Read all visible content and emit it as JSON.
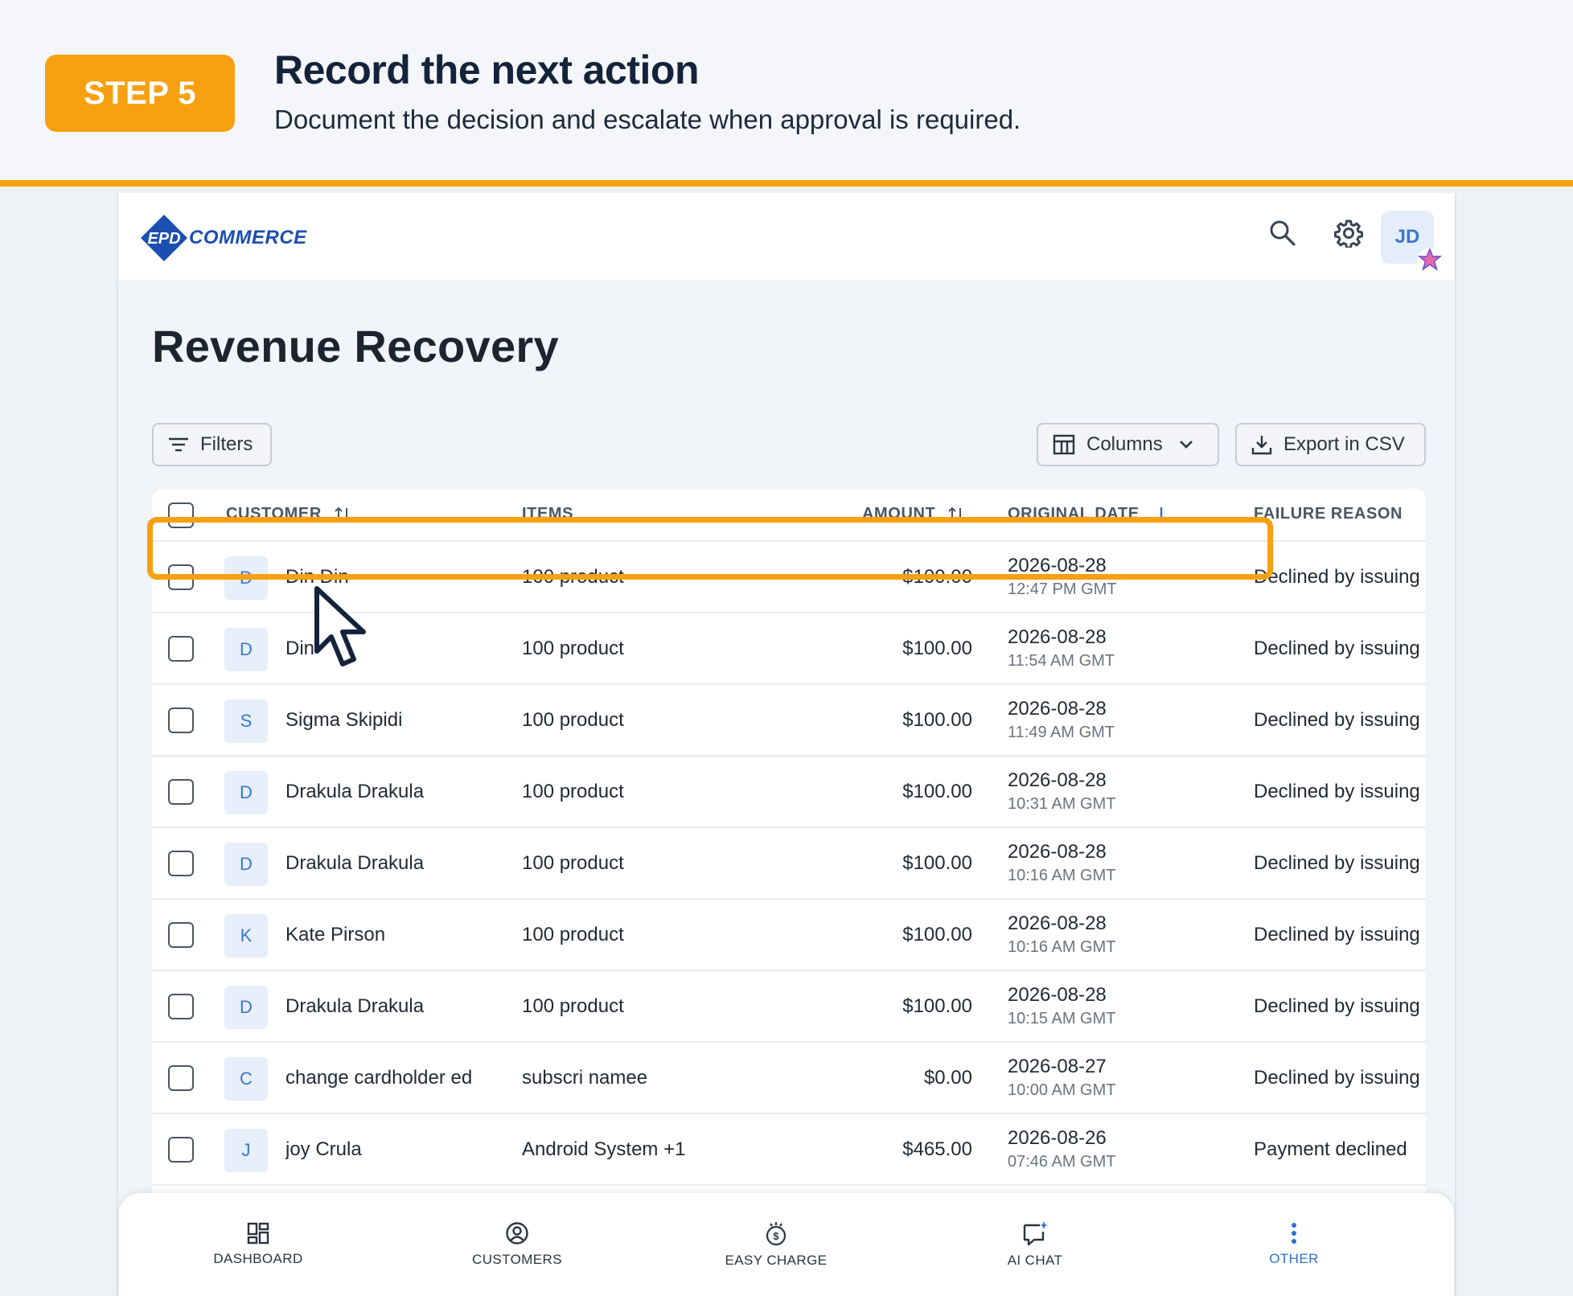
{
  "step": {
    "badge": "STEP 5",
    "title": "Record the next action",
    "subtitle": "Document the decision and escalate when approval is required.",
    "accent_color": "#f6a012"
  },
  "app": {
    "logo_mark_text": "EPD",
    "logo_text": "COMMERCE",
    "avatar_initials": "JD",
    "page_title": "Revenue Recovery"
  },
  "toolbar": {
    "filters_label": "Filters",
    "columns_label": "Columns",
    "export_label": "Export in CSV"
  },
  "table": {
    "headers": {
      "customer": "CUSTOMER",
      "items": "ITEMS",
      "amount": "AMOUNT",
      "original_date": "ORIGINAL DATE",
      "failure_reason": "FAILURE REASON"
    },
    "rows": [
      {
        "initial": "D",
        "name": "Din Din",
        "items": "100 product",
        "amount": "$100.00",
        "date": "2026-08-28",
        "time": "12:47 PM GMT",
        "reason": "Declined by issuing"
      },
      {
        "initial": "D",
        "name": "Din",
        "items": "100 product",
        "amount": "$100.00",
        "date": "2026-08-28",
        "time": "11:54 AM GMT",
        "reason": "Declined by issuing"
      },
      {
        "initial": "S",
        "name": "Sigma Skipidi",
        "items": "100 product",
        "amount": "$100.00",
        "date": "2026-08-28",
        "time": "11:49 AM GMT",
        "reason": "Declined by issuing"
      },
      {
        "initial": "D",
        "name": "Drakula Drakula",
        "items": "100 product",
        "amount": "$100.00",
        "date": "2026-08-28",
        "time": "10:31 AM GMT",
        "reason": "Declined by issuing"
      },
      {
        "initial": "D",
        "name": "Drakula Drakula",
        "items": "100 product",
        "amount": "$100.00",
        "date": "2026-08-28",
        "time": "10:16 AM GMT",
        "reason": "Declined by issuing"
      },
      {
        "initial": "K",
        "name": "Kate Pirson",
        "items": "100 product",
        "amount": "$100.00",
        "date": "2026-08-28",
        "time": "10:16 AM GMT",
        "reason": "Declined by issuing"
      },
      {
        "initial": "D",
        "name": "Drakula Drakula",
        "items": "100 product",
        "amount": "$100.00",
        "date": "2026-08-28",
        "time": "10:15 AM GMT",
        "reason": "Declined by issuing"
      },
      {
        "initial": "C",
        "name": "change cardholder ed",
        "items": "subscri namee",
        "amount": "$0.00",
        "date": "2026-08-27",
        "time": "10:00 AM GMT",
        "reason": "Declined by issuing"
      },
      {
        "initial": "J",
        "name": "joy Crula",
        "items": "Android System +1",
        "amount": "$465.00",
        "date": "2026-08-26",
        "time": "07:46 AM GMT",
        "reason": "Payment declined"
      }
    ]
  },
  "bottom_nav": [
    {
      "label": "DASHBOARD",
      "icon": "dashboard-icon"
    },
    {
      "label": "CUSTOMERS",
      "icon": "customers-icon"
    },
    {
      "label": "EASY CHARGE",
      "icon": "easy-charge-icon"
    },
    {
      "label": "AI CHAT",
      "icon": "ai-chat-icon"
    },
    {
      "label": "OTHER",
      "icon": "more-vertical-icon",
      "active": true
    }
  ],
  "colors": {
    "brand_blue": "#1a4fb0",
    "active_nav": "#2f6fd0",
    "initial_bg": "#e6effa"
  }
}
